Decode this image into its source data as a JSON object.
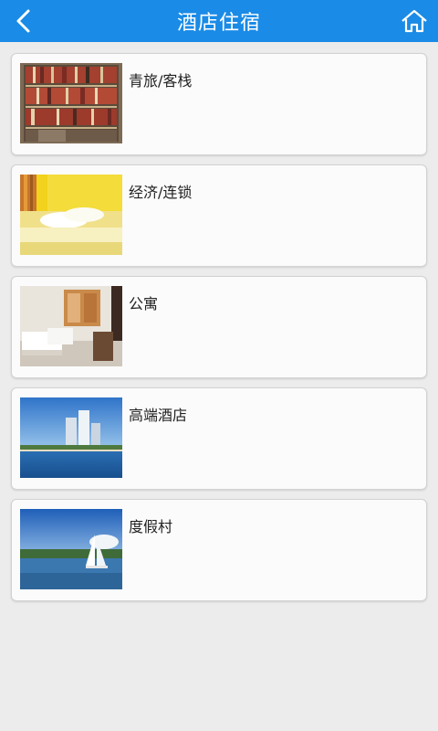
{
  "header": {
    "title": "酒店住宿",
    "back_icon": "chevron-left-icon",
    "home_icon": "home-icon"
  },
  "categories": [
    {
      "label": "青旅/客栈",
      "image": "bookshelf-photo"
    },
    {
      "label": "经济/连锁",
      "image": "yellow-bedroom-photo"
    },
    {
      "label": "公寓",
      "image": "apartment-room-photo"
    },
    {
      "label": "高端酒店",
      "image": "seaside-towers-photo"
    },
    {
      "label": "度假村",
      "image": "sailboat-harbor-photo"
    }
  ],
  "colors": {
    "header_bg": "#1a8be6",
    "page_bg": "#ececec",
    "card_bg": "#fbfbfb"
  }
}
